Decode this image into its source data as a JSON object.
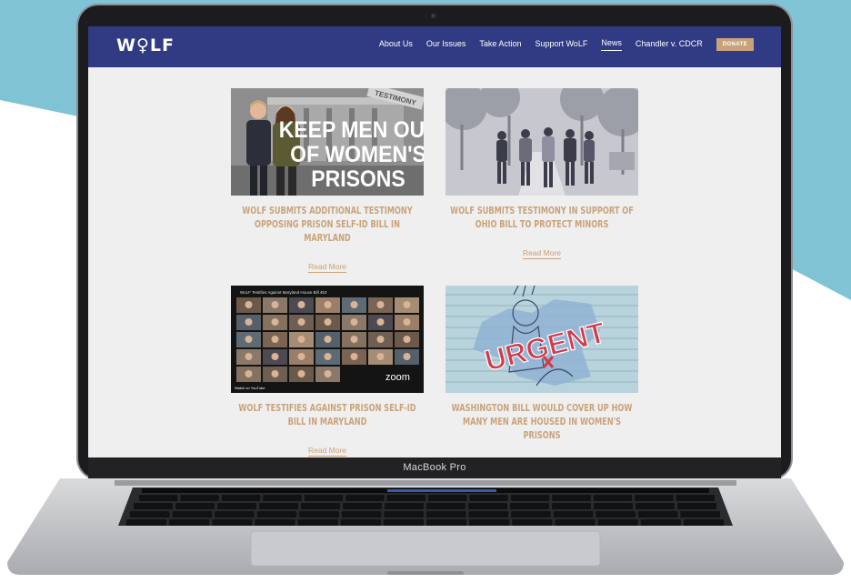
{
  "device": {
    "label": "MacBook Pro"
  },
  "site": {
    "logo": "W♀LF",
    "nav": [
      {
        "label": "About Us",
        "active": false
      },
      {
        "label": "Our Issues",
        "active": false
      },
      {
        "label": "Take Action",
        "active": false
      },
      {
        "label": "Support WoLF",
        "active": false
      },
      {
        "label": "News",
        "active": true
      },
      {
        "label": "Chandler v. CDCR",
        "active": false
      }
    ],
    "donate_label": "DONATE",
    "colors": {
      "nav": "#303b84",
      "accent": "#c9a27a",
      "page": "#efefef",
      "backdrop": "#7fc3d5"
    }
  },
  "articles": [
    {
      "title": "WoLF Submits Additional Testimony Opposing Prison Self-ID Bill in Maryland",
      "read_more": "Read More",
      "image_text": [
        "KEEP MEN OUT",
        "OF WOMEN'S",
        "PRISONS"
      ],
      "image_stamp": "TESTIMONY"
    },
    {
      "title": "WoLF Submits Testimony in Support of Ohio Bill to Protect Minors",
      "read_more": "Read More"
    },
    {
      "title": "WoLF Testifies Against Prison Self-ID Bill in Maryland",
      "read_more": "Read More",
      "image_header": "WoLF Testifies Against Maryland House Bill 453",
      "image_brand": "zoom",
      "image_footer": "Watch on YouTube"
    },
    {
      "title": "Washington Bill Would Cover Up How Many Men Are Housed in Women's Prisons",
      "read_more": "",
      "image_text": "URGENT"
    }
  ]
}
